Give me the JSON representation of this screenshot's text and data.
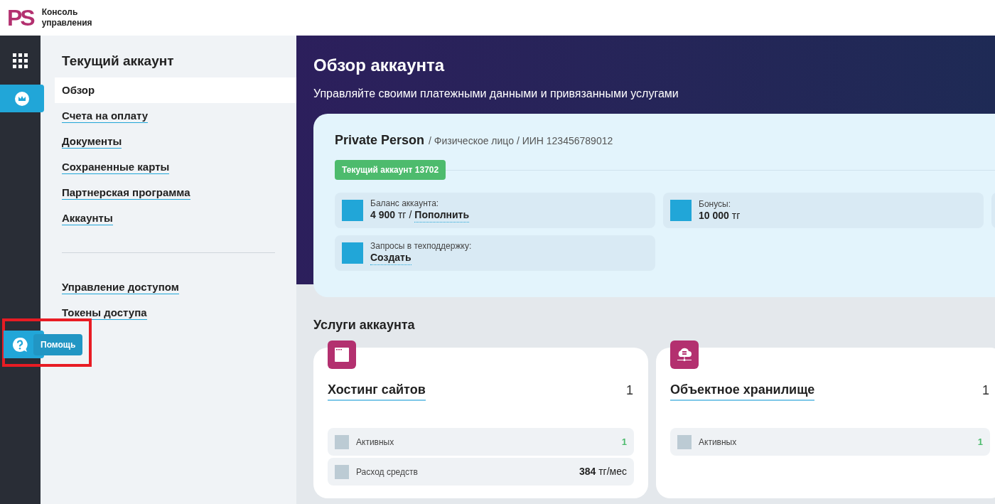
{
  "header": {
    "logo": "PS",
    "title_lines": [
      "Консоль",
      "управления"
    ]
  },
  "rail": {
    "items": [
      {
        "kind": "apps",
        "selected": false
      },
      {
        "kind": "account",
        "selected": true
      }
    ],
    "help": {
      "tooltip": "Помощь"
    }
  },
  "sidebar": {
    "title": "Текущий аккаунт",
    "items": [
      {
        "label": "Обзор",
        "selected": true
      },
      {
        "label": "Счета на оплату",
        "selected": false
      },
      {
        "label": "Документы",
        "selected": false
      },
      {
        "label": "Сохраненные карты",
        "selected": false
      },
      {
        "label": "Партнерская программа",
        "selected": false
      },
      {
        "label": "Аккаунты",
        "selected": false
      }
    ],
    "access_items": [
      {
        "label": "Управление доступом",
        "selected": false
      },
      {
        "label": "Токены доступа",
        "selected": false
      }
    ]
  },
  "page": {
    "title": "Обзор аккаунта",
    "subtitle": "Управляйте своими платежными данными и привязанными услугами"
  },
  "account": {
    "name": "Private Person",
    "details": "/ Физическое лицо / ИИН 123456789012",
    "badge": "Текущий аккаунт 13702",
    "stats": [
      {
        "label": "Баланс аккаунта:",
        "value": "4 900",
        "unit": "тг",
        "separator": "/",
        "link": "Пополнить"
      },
      {
        "label": "Бонусы:",
        "value": "10 000",
        "unit": "тг"
      },
      {
        "label": "Запросы в техподдержку:",
        "link": "Создать"
      }
    ]
  },
  "services": {
    "title": "Услуги аккаунта",
    "cards": [
      {
        "kind": "window",
        "name": "Хостинг сайтов",
        "count": "1",
        "rows": [
          {
            "kind": "count",
            "label": "Активных",
            "value": "1"
          },
          {
            "kind": "money",
            "label": "Расход средств",
            "value": "384",
            "unit": "тг/мес"
          }
        ]
      },
      {
        "kind": "cloud",
        "name": "Объектное хранилище",
        "count": "1",
        "rows": [
          {
            "kind": "count",
            "label": "Активных",
            "value": "1"
          }
        ]
      }
    ]
  }
}
